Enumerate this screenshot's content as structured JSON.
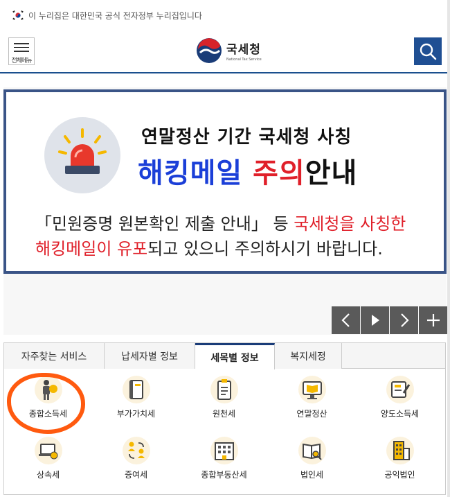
{
  "gov_notice": "이 누리집은 대한민국 공식 전자정부 누리집입니다",
  "header": {
    "menu_label": "전체메뉴",
    "logo_ko": "국세청",
    "logo_en": "National Tax Service"
  },
  "banner": {
    "line1": "연말정산 기간 국세청 사칭",
    "line2_blue": "해킹메일 ",
    "line2_red": "주의",
    "line2_black": "안내",
    "line3_black": "「민원증명 원본확인 제출 안내」 등 ",
    "line3_red": "국세청을 사칭한",
    "line4_red": "해킹메일이 유포",
    "line4_black": "되고 있으니 주의하시기 바랍니다."
  },
  "tabs": [
    {
      "label": "자주찾는 서비스",
      "active": false
    },
    {
      "label": "납세자별 정보",
      "active": false
    },
    {
      "label": "세목별 정보",
      "active": true
    },
    {
      "label": "복지세정",
      "active": false
    }
  ],
  "services": [
    {
      "label": "종합소득세",
      "icon": "person-icon"
    },
    {
      "label": "부가가치세",
      "icon": "book-icon"
    },
    {
      "label": "원천세",
      "icon": "clipboard-icon"
    },
    {
      "label": "연말정산",
      "icon": "monitor-book-icon"
    },
    {
      "label": "양도소득세",
      "icon": "document-pen-icon"
    },
    {
      "label": "상속세",
      "icon": "laptop-coin-icon"
    },
    {
      "label": "증여세",
      "icon": "people-exchange-icon"
    },
    {
      "label": "종합부동산세",
      "icon": "buildings-icon"
    },
    {
      "label": "법인세",
      "icon": "book-magnifier-icon"
    },
    {
      "label": "공익법인",
      "icon": "building-icon"
    }
  ],
  "colors": {
    "brand_blue": "#1f4f93",
    "banner_border": "#3a5487",
    "warning_red": "#e0202a",
    "headline_blue": "#1b3fd8",
    "highlight_orange": "#ff5a0f",
    "icon_yellow": "#f5b800"
  }
}
